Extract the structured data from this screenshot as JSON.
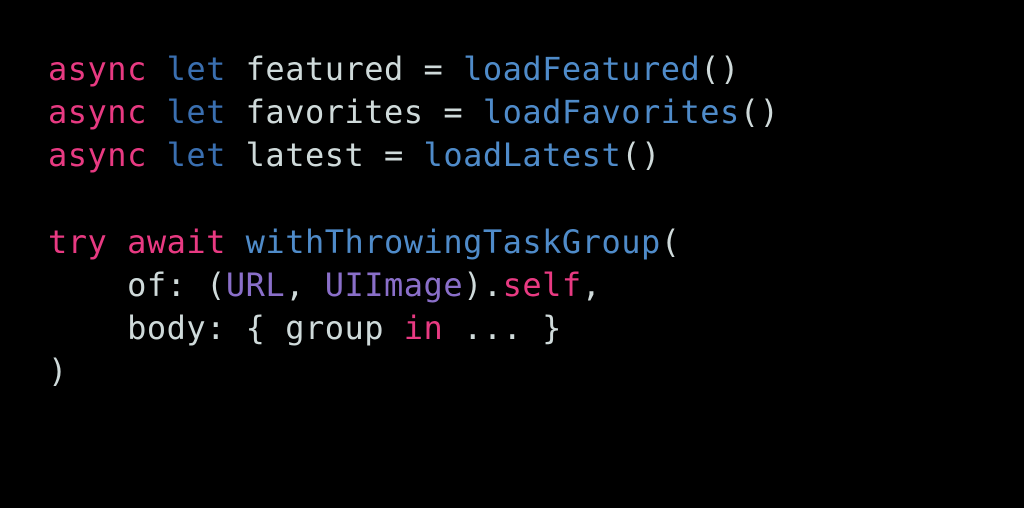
{
  "colors": {
    "background": "#000000",
    "keyword_pink": "#e83a82",
    "keyword_blue": "#3a6fb0",
    "function": "#4f8bc9",
    "type": "#8a6fc9",
    "plain": "#cfdada"
  },
  "code": {
    "l1": {
      "async": "async",
      "let": "let",
      "name": " featured ",
      "eq": "= ",
      "fn": "loadFeatured",
      "paren": "()"
    },
    "l2": {
      "async": "async",
      "let": "let",
      "name": " favorites ",
      "eq": "= ",
      "fn": "loadFavorites",
      "paren": "()"
    },
    "l3": {
      "async": "async",
      "let": "let",
      "name": " latest ",
      "eq": "= ",
      "fn": "loadLatest",
      "paren": "()"
    },
    "l4": "",
    "l5": {
      "try": "try",
      "sp": " ",
      "await": "await",
      "sp2": " ",
      "fn": "withThrowingTaskGroup",
      "paren": "("
    },
    "l6": {
      "indent": "    ",
      "of": "of",
      "colon": ": (",
      "t1": "URL",
      "comma": ", ",
      "t2": "UIImage",
      "close": ").",
      "self": "self",
      "comma2": ","
    },
    "l7": {
      "indent": "    ",
      "body": "body",
      "colon": ": { group ",
      "in": "in",
      "rest": " ... }"
    },
    "l8": {
      "paren": ")"
    }
  }
}
